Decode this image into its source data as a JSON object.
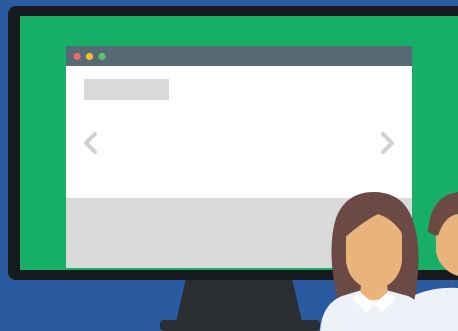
{
  "scene": {
    "colors": {
      "background": "#2a5aa0",
      "monitor_frame": "#161a1f",
      "monitor_screen": "#17ae66",
      "stand": "#2a2e33",
      "browser_titlebar": "#556a74",
      "browser_body": "#ffffff",
      "placeholder_gray": "#d9d9d9",
      "dot_red": "#ee6b67",
      "dot_yellow": "#f2c12e",
      "dot_green": "#5fbf6a",
      "arrow_gray": "#cfcfcf",
      "hair": "#6b4a45",
      "skin": "#e9b47b",
      "shirt": "#eef2f8"
    },
    "icons": {
      "prev": "chevron-left-icon",
      "next": "chevron-right-icon"
    }
  }
}
